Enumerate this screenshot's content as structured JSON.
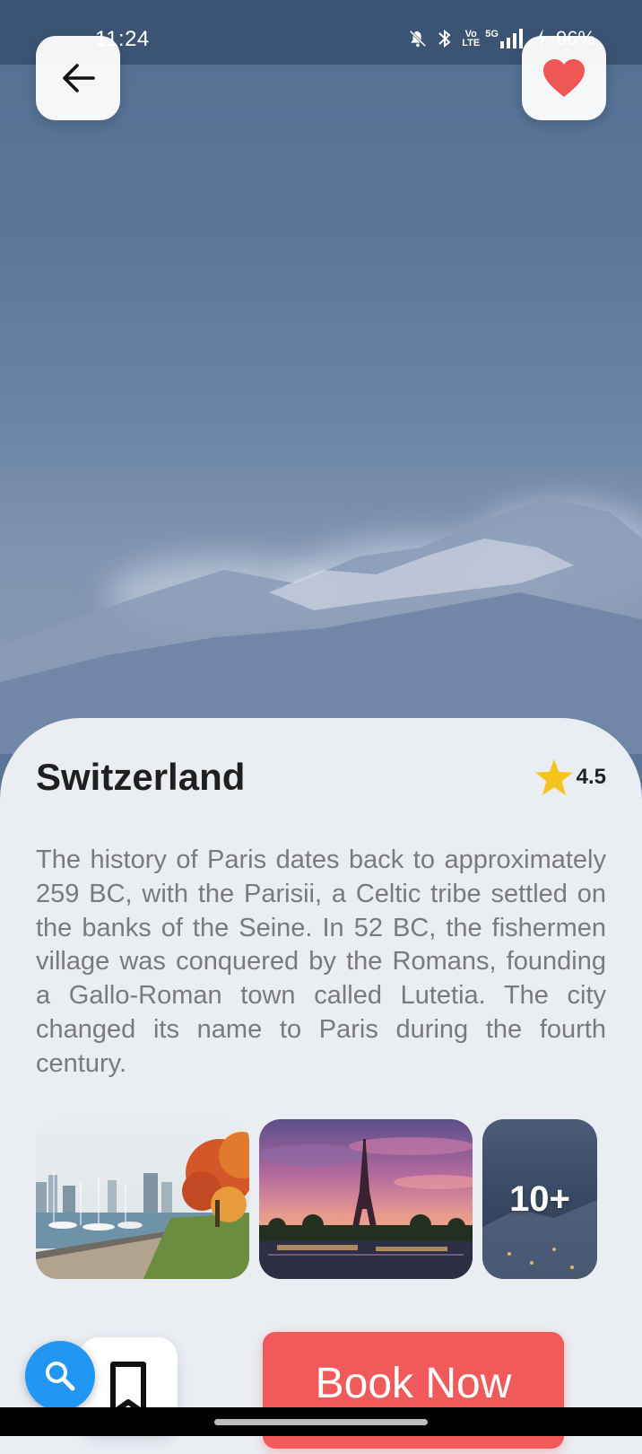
{
  "status_bar": {
    "time": "11:24",
    "icons": [
      "mute-icon",
      "bluetooth-icon",
      "volte-icon",
      "5g-signal-icon",
      "charging-icon"
    ],
    "volte_label": "Vo LTE",
    "network_label": "5G",
    "battery": "96%"
  },
  "header": {
    "back_icon": "arrow-left-icon",
    "favorite_icon": "heart-icon",
    "favorite_color": "#f25757"
  },
  "destination": {
    "title": "Switzerland",
    "rating": "4.5",
    "rating_icon": "star-icon",
    "star_color": "#f6c21c",
    "description": "The history of Paris dates back to approximately 259 BC, with the Parisii, a Celtic tribe settled on the banks of the Seine. In 52 BC, the fishermen village was conquered by the Romans, founding a Gallo-Roman town called Lutetia. The city changed its name to Paris during the fourth century."
  },
  "gallery": {
    "photos": [
      "harbor-autumn-photo",
      "eiffel-tower-sunset-photo"
    ],
    "more_label": "10+"
  },
  "actions": {
    "book_label": "Book Now",
    "book_color": "#f05a5a",
    "search_color": "#2196f3",
    "bookmark_icon": "bookmark-icon",
    "search_icon": "search-icon"
  }
}
